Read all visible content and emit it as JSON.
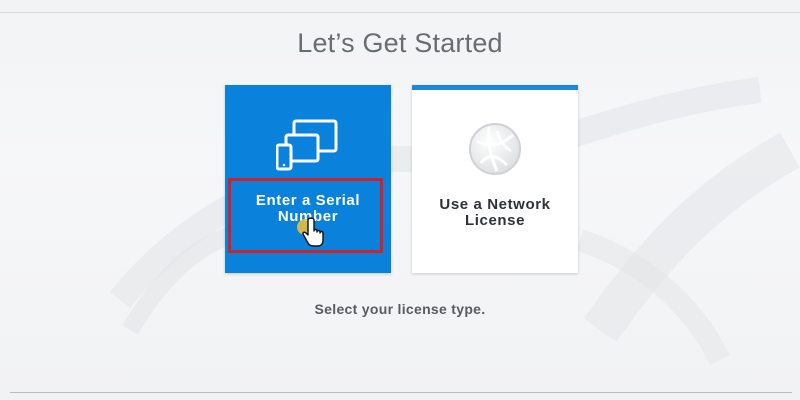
{
  "page": {
    "title": "Let’s Get Started",
    "instruction": "Select your license type."
  },
  "options": {
    "serial": {
      "label_line1": "Enter a Serial",
      "label_line2": "Number",
      "icon": "devices-icon"
    },
    "network": {
      "label_line1": "Use a Network",
      "label_line2": "License",
      "icon": "globe-network-icon"
    }
  },
  "colors": {
    "serial_tile_bg": "#0a82dc",
    "network_tile_accent": "#1a88e0",
    "highlight_border": "#d0202a",
    "title_text": "#6a6c70"
  }
}
